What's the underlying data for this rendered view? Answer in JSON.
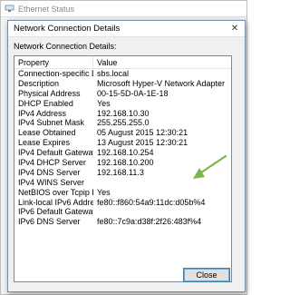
{
  "background_window": {
    "title": "Ethernet Status",
    "side_fragments": [
      "Se",
      "r",
      "up",
      "io",
      "ptio",
      "a"
    ]
  },
  "dialog": {
    "title": "Network Connection Details",
    "section_label": "Network Connection Details:",
    "columns": {
      "property": "Property",
      "value": "Value"
    },
    "rows": [
      {
        "property": "Connection-specific DN...",
        "value": "sbs.local"
      },
      {
        "property": "Description",
        "value": "Microsoft Hyper-V Network Adapter"
      },
      {
        "property": "Physical Address",
        "value": "00-15-5D-0A-1E-18"
      },
      {
        "property": "DHCP Enabled",
        "value": "Yes"
      },
      {
        "property": "IPv4 Address",
        "value": "192.168.10.30"
      },
      {
        "property": "IPv4 Subnet Mask",
        "value": "255.255.255.0"
      },
      {
        "property": "Lease Obtained",
        "value": "05 August 2015 12:30:21"
      },
      {
        "property": "Lease Expires",
        "value": "13 August 2015 12:30:21"
      },
      {
        "property": "IPv4 Default Gateway",
        "value": "192.168.10.254"
      },
      {
        "property": "IPv4 DHCP Server",
        "value": "192.168.10.200"
      },
      {
        "property": "IPv4 DNS Server",
        "value": "192.168.11.3"
      },
      {
        "property": "IPv4 WINS Server",
        "value": ""
      },
      {
        "property": "NetBIOS over Tcpip En...",
        "value": "Yes"
      },
      {
        "property": "Link-local IPv6 Address",
        "value": "fe80::f860:54a9:11dc:d05b%4"
      },
      {
        "property": "IPv6 Default Gateway",
        "value": ""
      },
      {
        "property": "IPv6 DNS Server",
        "value": "fe80::7c9a:d38f:2f26:483f%4"
      }
    ],
    "close_button_label": "Close",
    "annotation": {
      "arrow_color": "#7ab648",
      "points_to_row": "IPv4 DHCP Server"
    }
  }
}
